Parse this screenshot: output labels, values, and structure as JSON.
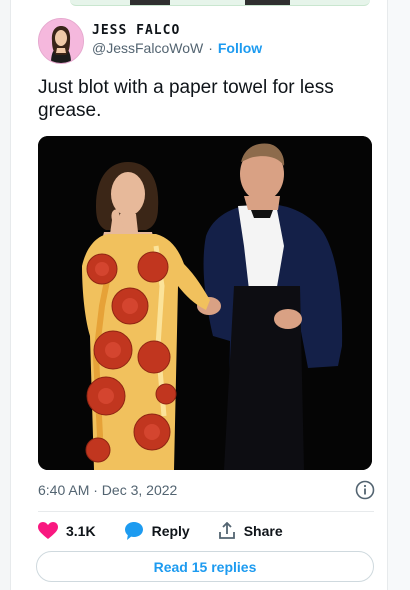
{
  "author": {
    "display_name": "JESS FALCO",
    "username": "@JessFalcoWoW",
    "separator": "·",
    "follow_label": "Follow"
  },
  "tweet": {
    "text": "Just blot with a paper towel for less grease.",
    "timestamp": "6:40 AM · Dec 3, 2022"
  },
  "actions": {
    "likes": "3.1K",
    "reply_label": "Reply",
    "share_label": "Share"
  },
  "read_replies_label": "Read 15 replies",
  "colors": {
    "accent": "#1d9bf0",
    "like": "#f91880",
    "text": "#0f1419",
    "muted": "#536471"
  },
  "icons": [
    "heart-icon",
    "reply-bubble-icon",
    "share-icon",
    "info-icon"
  ]
}
